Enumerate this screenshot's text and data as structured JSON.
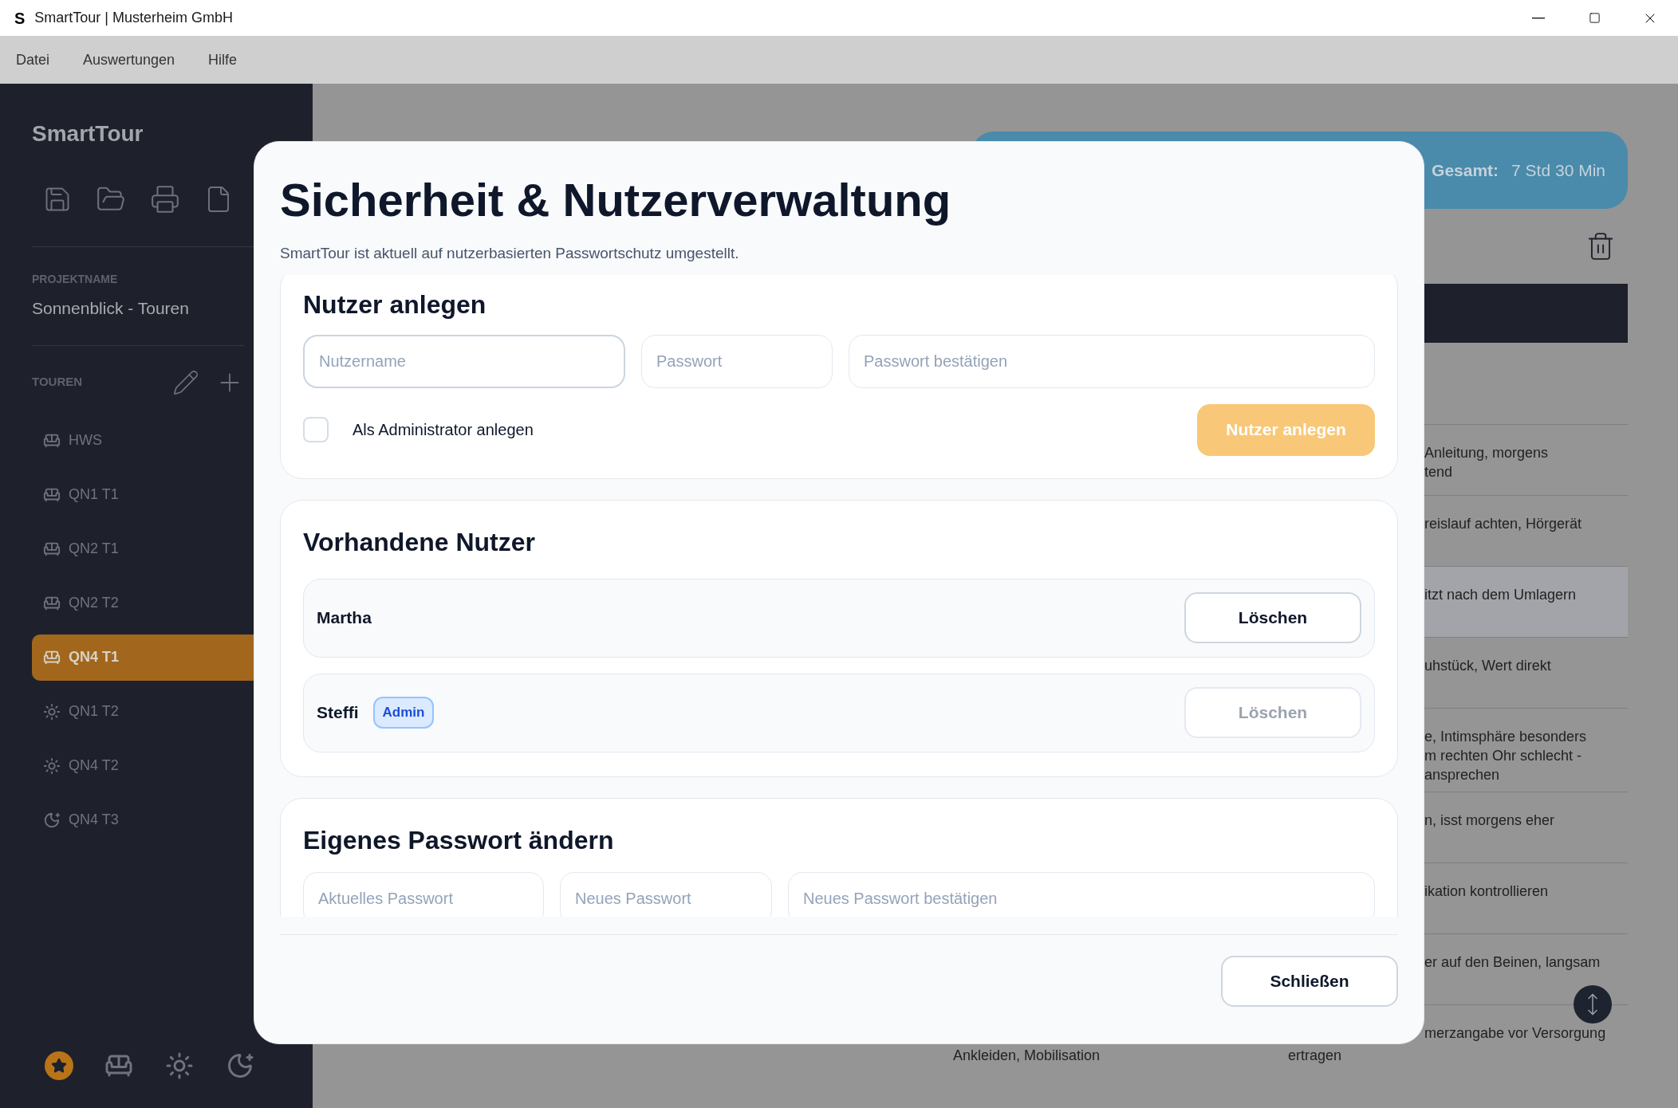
{
  "window": {
    "logo_letter": "S",
    "title": "SmartTour | Musterheim GmbH"
  },
  "menu": [
    {
      "label": "Datei"
    },
    {
      "label": "Auswertungen"
    },
    {
      "label": "Hilfe"
    }
  ],
  "sidebar": {
    "app_name": "SmartTour",
    "project_label": "PROJEKTNAME",
    "project_name": "Sonnenblick - Touren",
    "tours_label": "TOUREN",
    "tours": [
      {
        "label": "HWS",
        "kind": "sofa",
        "selected": false
      },
      {
        "label": "QN1 T1",
        "kind": "sofa",
        "selected": false
      },
      {
        "label": "QN2 T1",
        "kind": "sofa",
        "selected": false
      },
      {
        "label": "QN2 T2",
        "kind": "sofa",
        "selected": false
      },
      {
        "label": "QN4 T1",
        "kind": "sofa",
        "selected": true
      },
      {
        "label": "QN1 T2",
        "kind": "sun",
        "selected": false
      },
      {
        "label": "QN4 T2",
        "kind": "sun",
        "selected": false
      },
      {
        "label": "QN4 T3",
        "kind": "moon",
        "selected": false
      }
    ],
    "filters": [
      {
        "kind": "star",
        "selected": true
      },
      {
        "kind": "sofa",
        "selected": false
      },
      {
        "kind": "sun",
        "selected": false
      },
      {
        "kind": "moon",
        "selected": false
      }
    ]
  },
  "summary": {
    "label": "Gesamt:",
    "value": "7 Std 30 Min"
  },
  "table": {
    "rows": [
      {
        "note": [
          "Anleitung, morgens",
          "tend"
        ],
        "highlighted": false
      },
      {
        "note": [
          "reislauf achten, Hörgerät"
        ],
        "highlighted": false
      },
      {
        "note": [
          "itzt nach dem Umlagern"
        ],
        "highlighted": true
      },
      {
        "note": [
          "uhstück, Wert direkt"
        ],
        "highlighted": false
      },
      {
        "note": [
          "e, Intimsphäre besonders",
          "m rechten Ohr schlecht -",
          "ansprechen"
        ],
        "highlighted": false
      },
      {
        "note": [
          "n, isst morgens eher"
        ],
        "highlighted": false
      },
      {
        "note": [
          "ikation kontrollieren"
        ],
        "highlighted": false
      },
      {
        "note": [
          "er auf den Beinen, langsam"
        ],
        "highlighted": false
      },
      {
        "note": [
          "merzangabe vor Versorgung"
        ],
        "column_1": "Ankleiden, Mobilisation",
        "column_2": "ertragen",
        "highlighted": false
      }
    ]
  },
  "dialog": {
    "title": "Sicherheit & Nutzerverwaltung",
    "subtitle": "SmartTour ist aktuell auf nutzerbasierten Passwortschutz umgestellt.",
    "create_user": {
      "heading": "Nutzer anlegen",
      "fields": [
        {
          "placeholder": "Nutzername",
          "focused": true
        },
        {
          "placeholder": "Passwort",
          "focused": false
        },
        {
          "placeholder": "Passwort bestätigen",
          "focused": false
        }
      ],
      "admin_checkbox": {
        "label": "Als Administrator anlegen",
        "checked": false
      },
      "submit": {
        "label": "Nutzer anlegen",
        "disabled": true
      }
    },
    "users": {
      "heading": "Vorhandene Nutzer",
      "items": [
        {
          "name": "Martha",
          "delete": {
            "label": "Löschen",
            "disabled": false
          }
        },
        {
          "name": "Steffi",
          "badge": "Admin",
          "delete": {
            "label": "Löschen",
            "disabled": true
          }
        }
      ]
    },
    "change_password": {
      "heading": "Eigenes Passwort ändern",
      "fields": [
        {
          "placeholder": "Aktuelles Passwort"
        },
        {
          "placeholder": "Neues Passwort"
        },
        {
          "placeholder": "Neues Passwort bestätigen"
        }
      ]
    },
    "close_button": {
      "label": "Schließen"
    }
  }
}
